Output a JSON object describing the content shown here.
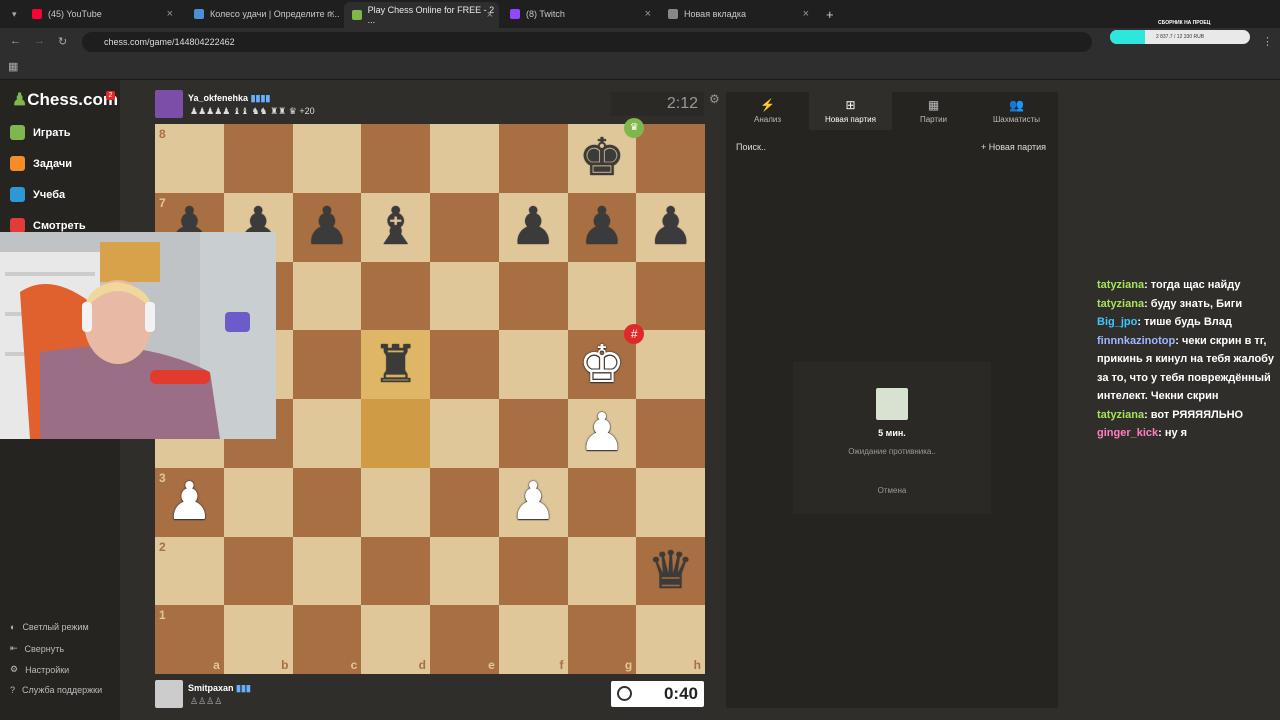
{
  "browser": {
    "tabs": [
      {
        "title": "(45) YouTube",
        "color": "#ff0033"
      },
      {
        "title": "Колесо удачи | Определите п...",
        "color": "#4a90d9"
      },
      {
        "title": "Play Chess Online for FREE - 2 ...",
        "color": "#81b64c"
      },
      {
        "title": "(8) Twitch",
        "color": "#9146ff"
      },
      {
        "title": "Новая вкладка",
        "color": "#888888"
      }
    ],
    "url": "chess.com/game/144804222462",
    "stream_title": "СБОРНИК НА ПРОЕЦ",
    "stream_progress": "2 837.7 / 12 330 RUB"
  },
  "sidebar": {
    "logo": "Chess.com",
    "notif_count": "2",
    "items": [
      {
        "label": "Играть",
        "color": "#81b64c"
      },
      {
        "label": "Задачи",
        "color": "#f48d27"
      },
      {
        "label": "Учеба",
        "color": "#2c99d6"
      },
      {
        "label": "Смотреть",
        "color": "#e33a3a"
      }
    ],
    "bottom": [
      "Светлый режим",
      "Свернуть",
      "Настройки",
      "Служба поддержки"
    ]
  },
  "game": {
    "top_player": {
      "name": "Ya_okfenehka",
      "flag": "▮▮▮▮",
      "captured": "♟♟♟♟♟ ♝♝ ♞♞ ♜♜ ♛ +20"
    },
    "bottom_player": {
      "name": "Smitpaxan",
      "flag": "▮▮▮",
      "captured": "♙♙♙♙"
    },
    "top_clock": "2:12",
    "bottom_clock": "0:40",
    "files": [
      "a",
      "b",
      "c",
      "d",
      "e",
      "f",
      "g",
      "h"
    ],
    "ranks": [
      "8",
      "7",
      "6",
      "5",
      "4",
      "3",
      "2",
      "1"
    ],
    "pieces": {
      "g8": "bk",
      "a7": "bp",
      "b7": "bp",
      "c7": "bp",
      "d7": "bb",
      "f7": "bp",
      "g7": "bp",
      "h7": "bp",
      "d5": "br",
      "g5": "wk",
      "g4": "wp",
      "a3": "wp",
      "f3": "wp",
      "h2": "bq"
    },
    "highlight": [
      "d5",
      "d4"
    ]
  },
  "panel": {
    "tabs": [
      {
        "label": "Анализ",
        "icon": "⚡"
      },
      {
        "label": "Новая партия",
        "icon": "⊞"
      },
      {
        "label": "Партии",
        "icon": "▦"
      },
      {
        "label": "Шахматисты",
        "icon": "👥"
      }
    ],
    "search": "Поиск..",
    "new_game": "Новая партия",
    "time_control": "5 мин.",
    "waiting": "Ожидание противника..",
    "cancel": "Отмена"
  },
  "chat": [
    {
      "user": "tatyziana",
      "color": "#a8e25a",
      "text": "тогда щас найду"
    },
    {
      "user": "tatyziana",
      "color": "#a8e25a",
      "text": "буду знать, Биги"
    },
    {
      "user": "Big_jpo",
      "color": "#3ec6ff",
      "text": "тише будь Влад"
    },
    {
      "user": "finnnkazinotop",
      "color": "#9fb6ff",
      "text": "чеки скрин в тг, прикинь я кинул на тебя жалобу за то, что у тебя повреждённый интелект. Чекни скрин"
    },
    {
      "user": "tatyziana",
      "color": "#a8e25a",
      "text": "вот РЯЯЯЯЛЬНО"
    },
    {
      "user": "ginger_kick",
      "color": "#ff7fbf",
      "text": "ну я"
    }
  ]
}
